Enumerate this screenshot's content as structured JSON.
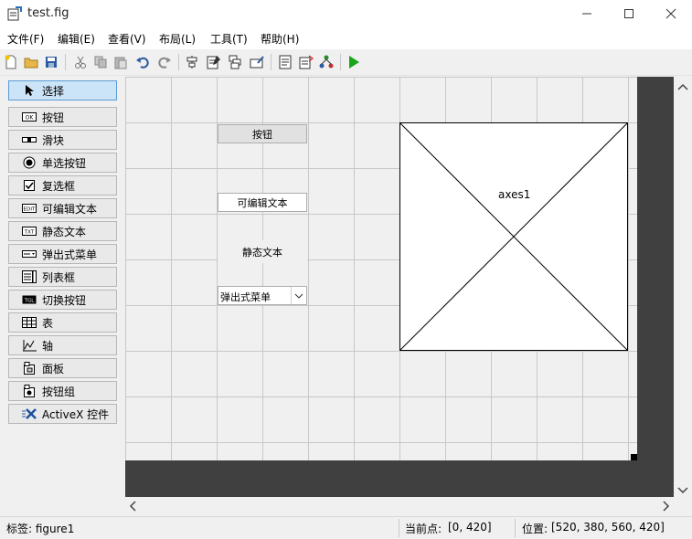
{
  "window": {
    "title": "test.fig"
  },
  "menubar": [
    "文件(F)",
    "编辑(E)",
    "查看(V)",
    "布局(L)",
    "工具(T)",
    "帮助(H)"
  ],
  "toolbar": {
    "icons": [
      "new-file-icon",
      "open-folder-icon",
      "save-icon",
      "cut-icon",
      "copy-icon",
      "paste-icon",
      "undo-icon",
      "redo-icon",
      "align-objects-icon",
      "menu-editor-icon",
      "tab-order-icon",
      "toolbar-editor-icon",
      "editor-icon",
      "property-inspector-icon",
      "object-browser-icon",
      "run-icon"
    ]
  },
  "palette": [
    {
      "label": "选择",
      "icon": "select-arrow-icon",
      "selected": true
    },
    {
      "label": "按钮",
      "icon": "pushbutton-icon"
    },
    {
      "label": "滑块",
      "icon": "slider-icon"
    },
    {
      "label": "单选按钮",
      "icon": "radio-button-icon"
    },
    {
      "label": "复选框",
      "icon": "checkbox-icon"
    },
    {
      "label": "可编辑文本",
      "icon": "edit-text-icon"
    },
    {
      "label": "静态文本",
      "icon": "static-text-icon"
    },
    {
      "label": "弹出式菜单",
      "icon": "popup-menu-icon"
    },
    {
      "label": "列表框",
      "icon": "listbox-icon"
    },
    {
      "label": "切换按钮",
      "icon": "toggle-button-icon"
    },
    {
      "label": "表",
      "icon": "table-icon"
    },
    {
      "label": "轴",
      "icon": "axes-icon"
    },
    {
      "label": "面板",
      "icon": "panel-icon"
    },
    {
      "label": "按钮组",
      "icon": "button-group-icon"
    },
    {
      "label": "ActiveX 控件",
      "icon": "activex-icon"
    }
  ],
  "palette_icon_text": {
    "pushbutton": "OK",
    "edit": "EDIT",
    "static": "TXT",
    "toggle": "TGL"
  },
  "canvas": {
    "pushbutton_label": "按钮",
    "edit_text_value": "可编辑文本",
    "static_text_value": "静态文本",
    "popup_value": "弹出式菜单",
    "axes_label": "axes1"
  },
  "statusbar": {
    "tag": "标签: figure1",
    "current_point_label": "当前点:",
    "current_point_value": "[0, 420]",
    "position_label": "位置:",
    "position_value": "[520, 380, 560, 420]"
  }
}
